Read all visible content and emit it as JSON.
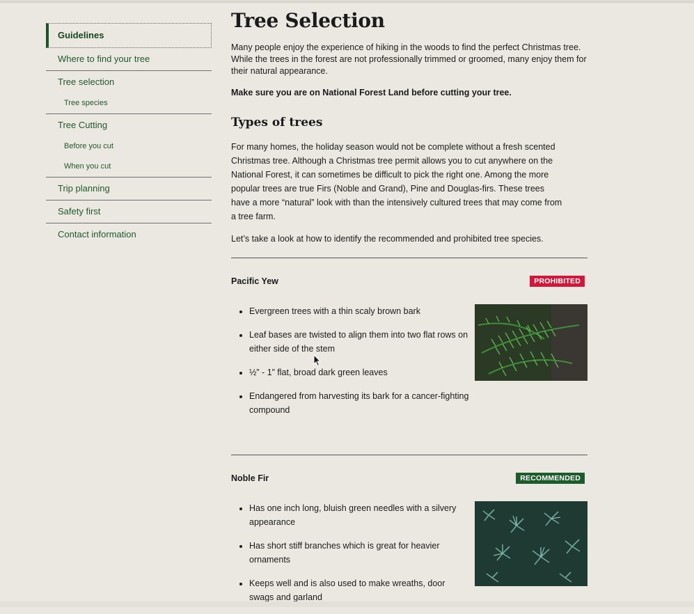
{
  "sidebar": {
    "items": [
      {
        "label": "Guidelines"
      },
      {
        "label": "Where to find your tree"
      },
      {
        "label": "Tree selection"
      },
      {
        "label": "Tree species"
      },
      {
        "label": "Tree Cutting"
      },
      {
        "label": "Before you cut"
      },
      {
        "label": "When you cut"
      },
      {
        "label": "Trip planning"
      },
      {
        "label": "Safety first"
      },
      {
        "label": "Contact information"
      }
    ]
  },
  "main": {
    "title": "Tree Selection",
    "intro": "Many people enjoy the experience of hiking in the woods to find the perfect Christmas tree. While the trees in the forest are not professionally trimmed or groomed, many enjoy them for their natural appearance.",
    "notice": "Make sure you are on National Forest Land before cutting your tree.",
    "types_heading": "Types of trees",
    "types_para": "For many homes, the holiday season would not be complete without a fresh scented Christmas tree. Although a Christmas tree permit allows you to cut anywhere on the National Forest, it can sometimes be difficult to pick the right one. Among the more popular trees are true Firs (Noble and Grand), Pine and Douglas-firs. These trees have a more “natural” look with than the intensively cultured trees that may come from a tree farm.",
    "lookup_para": "Let’s take a look at how to identify the recommended and prohibited tree species."
  },
  "trees": [
    {
      "name": "Pacific Yew",
      "status": "PROHIBITED",
      "facts": [
        "Evergreen trees with a thin scaly brown bark",
        "Leaf bases are twisted to align them into two flat rows on either side of the stem",
        "½” - 1” flat, broad dark green leaves",
        "Endangered from harvesting its bark for a cancer-fighting compound"
      ]
    },
    {
      "name": "Noble Fir",
      "status": "RECOMMENDED",
      "facts": [
        "Has one inch long, bluish green needles with a silvery appearance",
        "Has short stiff branches which is great for heavier ornaments",
        "Keeps well and is also used to make wreaths, door swags and garland"
      ]
    }
  ],
  "colors": {
    "link_green": "#21582b",
    "prohibited": "#d3173a",
    "recommended": "#1c5c2a",
    "background": "#ebe8e2"
  },
  "icons": [
    "pacific-yew-photo",
    "noble-fir-photo",
    "mouse-cursor-icon"
  ]
}
